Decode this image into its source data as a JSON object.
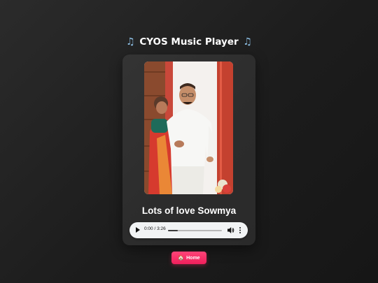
{
  "header": {
    "title": "CYOS Music Player",
    "left_icon": "music-note-icon",
    "right_icon": "music-note-icon"
  },
  "album_art": {
    "kind": "couple-photo"
  },
  "song": {
    "title": "Lots of love Sowmya"
  },
  "player": {
    "time_display": "0:00 / 3:26",
    "progress": 0.18,
    "play_icon": "play-icon",
    "volume_icon": "volume-icon",
    "more_icon": "more-vertical-icon"
  },
  "home_button": {
    "label": "Home",
    "icon": "home-icon",
    "color": "#f5245f"
  },
  "colors": {
    "background": "#222222",
    "card": "#3a3a3a",
    "accent": "#f5245f",
    "player_bg": "#f1f3f4"
  }
}
